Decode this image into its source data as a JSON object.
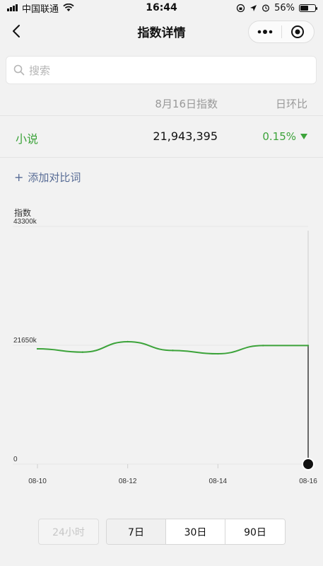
{
  "status_bar": {
    "carrier": "中国联通",
    "time": "16:44",
    "battery_percent": "56%",
    "battery_level": 0.56
  },
  "nav": {
    "title": "指数详情"
  },
  "search": {
    "placeholder": "搜索"
  },
  "table": {
    "header_date": "8月16日指数",
    "header_ratio": "日环比",
    "row": {
      "keyword": "小说",
      "value": "21,943,395",
      "ratio": "0.15%",
      "trend": "down"
    }
  },
  "add_compare": {
    "label": "添加对比词"
  },
  "chart_data": {
    "type": "line",
    "title": "",
    "ylabel": "指数",
    "ylim": [
      0,
      43300
    ],
    "y_tick_labels": [
      "43300k",
      "21650k",
      "0"
    ],
    "y_ticks": [
      43300,
      21650,
      0
    ],
    "x_tick_labels": [
      "08-10",
      "08-12",
      "08-14",
      "08-16"
    ],
    "x": [
      "08-10",
      "08-11",
      "08-12",
      "08-13",
      "08-14",
      "08-15",
      "08-16"
    ],
    "series": [
      {
        "values": [
          21000,
          20400,
          22300,
          20700,
          20100,
          21600,
          21600
        ],
        "color": "#3ca33a"
      }
    ],
    "marker_at": "08-16",
    "grid": false
  },
  "range": {
    "disabled_label": "24小时",
    "options": [
      "7日",
      "30日",
      "90日"
    ],
    "active_index": 0
  },
  "colors": {
    "accent_green": "#3ca33a",
    "link_blue": "#576b95"
  }
}
